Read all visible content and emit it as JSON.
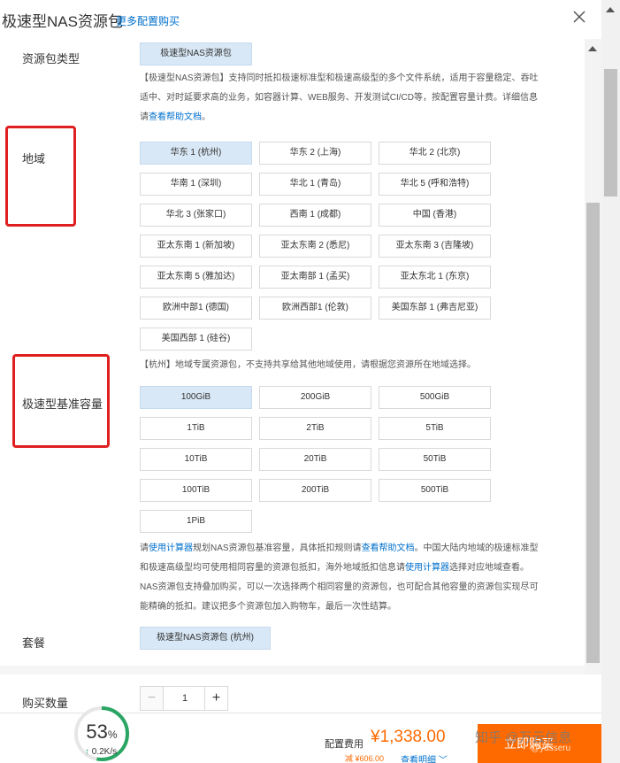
{
  "header": {
    "title": "极速型NAS资源包",
    "more_link": "更多配置购买"
  },
  "package_type": {
    "label": "资源包类型",
    "option": "极速型NAS资源包",
    "desc_line1": "【极速型NAS资源包】支持同时抵扣极速标准型和极速高级型的多个文件系统，适用于容量稳定、吞吐",
    "desc_line2": "适中、对时延要求高的业务，如容器计算、WEB服务、开发测试CI/CD等，按配置容量计费。详细信息",
    "desc_line3_prefix": "请",
    "desc_line3_link": "查看帮助文档",
    "desc_line3_suffix": "。"
  },
  "region": {
    "label": "地域",
    "options": [
      "华东 1 (杭州)",
      "华东 2 (上海)",
      "华北 2 (北京)",
      "华南 1 (深圳)",
      "华北 1 (青岛)",
      "华北 5 (呼和浩特)",
      "华北 3 (张家口)",
      "西南 1 (成都)",
      "中国 (香港)",
      "亚太东南 1 (新加坡)",
      "亚太东南 2 (悉尼)",
      "亚太东南 3 (吉隆坡)",
      "亚太东南 5 (雅加达)",
      "亚太南部 1 (孟买)",
      "亚太东北 1 (东京)",
      "欧洲中部1 (德国)",
      "欧洲西部1 (伦敦)",
      "美国东部 1 (弗吉尼亚)",
      "美国西部 1 (硅谷)"
    ],
    "note": "【杭州】地域专属资源包，不支持共享给其他地域使用，请根据您资源所在地域选择。"
  },
  "capacity": {
    "label": "极速型基准容量",
    "options": [
      "100GiB",
      "200GiB",
      "500GiB",
      "1TiB",
      "2TiB",
      "5TiB",
      "10TiB",
      "20TiB",
      "50TiB",
      "100TiB",
      "200TiB",
      "500TiB",
      "1PiB"
    ],
    "desc1_a": "请",
    "desc1_link1": "使用计算器",
    "desc1_b": "规划NAS资源包基准容量，具体抵扣规则请",
    "desc1_link2": "查看帮助文档",
    "desc1_c": "。中国大陆内地域的极速标准型",
    "desc2_a": "和极速高级型均可使用相同容量的资源包抵扣，海外地域抵扣信息请",
    "desc2_link": "使用计算器",
    "desc2_b": "选择对应地域查看。",
    "desc3": "NAS资源包支持叠加购买，可以一次选择两个相同容量的资源包，也可配合其他容量的资源包实现尽可",
    "desc4": "能精确的抵扣。建议把多个资源包加入购物车，最后一次性结算。"
  },
  "package": {
    "label": "套餐",
    "option": "极速型NAS资源包 (杭州)"
  },
  "quantity": {
    "label": "购买数量",
    "minus": "−",
    "value": "1",
    "plus": "+"
  },
  "footer": {
    "gauge_percent": "53",
    "gauge_percent_sign": "%",
    "gauge_speed": "0.2K/s",
    "gauge_arrow": "↑",
    "gauge_fill_fraction": 0.53,
    "config_fee_label": "配置费用",
    "price": "¥1,338.00",
    "discount": "减 ¥606.00",
    "detail_link": "查看明细",
    "buy_button": "立即购买",
    "watermark": "知乎 @万云信息",
    "watermark2": "@yasseru"
  },
  "colors": {
    "accent": "#0070cc",
    "selected_bg": "#d9e8f6",
    "price": "#ff6a00",
    "highlight_box": "#e02020",
    "gauge": "#2aa564"
  }
}
